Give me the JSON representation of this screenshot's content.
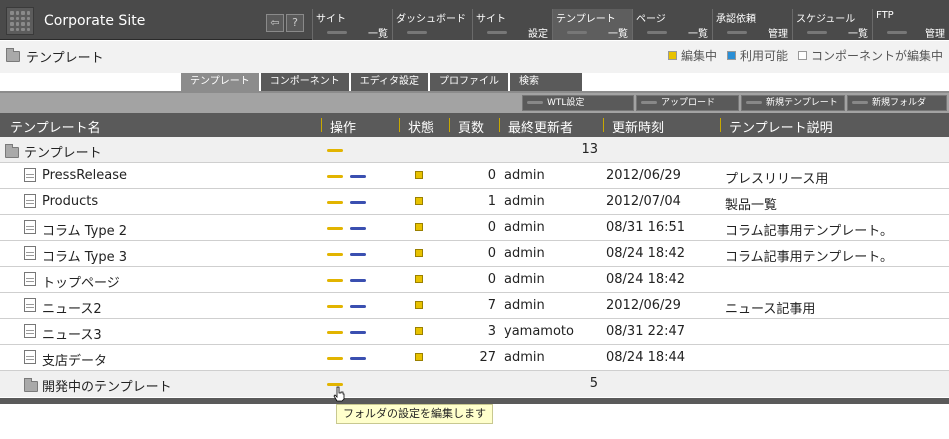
{
  "app": {
    "site_name": "Corporate Site",
    "mini_buttons": [
      "⇦",
      "?"
    ]
  },
  "nav": [
    {
      "top": "サイト",
      "bottom": "一覧"
    },
    {
      "top": "ダッシュボード",
      "bottom": ""
    },
    {
      "top": "サイト",
      "bottom": "設定"
    },
    {
      "top": "テンプレート",
      "bottom": "一覧"
    },
    {
      "top": "ページ",
      "bottom": "一覧"
    },
    {
      "top": "承認依頼",
      "bottom": "管理"
    },
    {
      "top": "スケジュール",
      "bottom": "一覧"
    },
    {
      "top": "FTP",
      "bottom": "管理"
    }
  ],
  "header": {
    "title": "テンプレート",
    "legend": {
      "editing": "編集中",
      "available": "利用可能",
      "component_editing": "コンポーネントが編集中",
      "colors": {
        "editing": "#e8c200",
        "available": "#2a8fd6",
        "component_editing": "#ffffff"
      }
    }
  },
  "tabs": [
    "テンプレート",
    "コンポーネント",
    "エディタ設定",
    "プロファイル",
    "検索"
  ],
  "toolbar": [
    "WTL設定",
    "アップロード",
    "新規テンプレート",
    "新規フォルダ"
  ],
  "table": {
    "columns": [
      "テンプレート名",
      "操作",
      "状態",
      "頁数",
      "最終更新者",
      "更新時刻",
      "テンプレート説明"
    ],
    "root": {
      "name": "テンプレート",
      "pages": "13"
    },
    "rows": [
      {
        "name": "PressRelease",
        "pages": "0",
        "user": "admin",
        "time": "2012/06/29",
        "desc": "プレスリリース用"
      },
      {
        "name": "Products",
        "pages": "1",
        "user": "admin",
        "time": "2012/07/04",
        "desc": "製品一覧"
      },
      {
        "name": "コラム Type 2",
        "pages": "0",
        "user": "admin",
        "time": "08/31 16:51",
        "desc": "コラム記事用テンプレート。"
      },
      {
        "name": "コラム Type 3",
        "pages": "0",
        "user": "admin",
        "time": "08/24 18:42",
        "desc": "コラム記事用テンプレート。"
      },
      {
        "name": "トップページ",
        "pages": "0",
        "user": "admin",
        "time": "08/24 18:42",
        "desc": ""
      },
      {
        "name": "ニュース2",
        "pages": "7",
        "user": "admin",
        "time": "2012/06/29",
        "desc": "ニュース記事用"
      },
      {
        "name": "ニュース3",
        "pages": "3",
        "user": "yamamoto",
        "time": "08/31 22:47",
        "desc": ""
      },
      {
        "name": "支店データ",
        "pages": "27",
        "user": "admin",
        "time": "08/24 18:44",
        "desc": ""
      }
    ],
    "subfolder": {
      "name": "開発中のテンプレート",
      "pages": "5"
    }
  },
  "tooltip": "フォルダの設定を編集します"
}
